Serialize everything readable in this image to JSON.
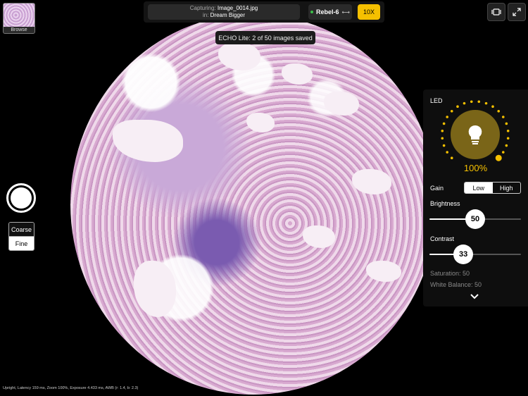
{
  "top": {
    "capturing_label": "Capturing:",
    "capturing_file": "Image_0014.jpg",
    "in_label": "in:",
    "in_folder": "Dream Bigger",
    "device_name": "Rebel-6",
    "device_link_icon": "link-icon",
    "objective": "10X"
  },
  "browse": {
    "label": "Browse"
  },
  "toast": {
    "text": "ECHO Lite: 2 of 50 images saved"
  },
  "focus": {
    "coarse": "Coarse",
    "fine": "Fine",
    "selected": "Fine"
  },
  "status": {
    "text": "Upright, Latency 159 ms, Zoom 100%, Exposure 4.433 ms, AWB (r: 1.4, b: 2.3)"
  },
  "panel": {
    "led_label": "LED",
    "led_icon": "lightbulb-icon",
    "led_percent": "100%",
    "led_level": 1.0,
    "gain_label": "Gain",
    "gain_low": "Low",
    "gain_high": "High",
    "gain_selected": "Low",
    "brightness_label": "Brightness",
    "brightness_value": "50",
    "brightness_level": 0.5,
    "contrast_label": "Contrast",
    "contrast_value": "33",
    "contrast_level": 0.37,
    "saturation_text": "Saturation: 50",
    "white_balance_text": "White Balance: 50",
    "collapse_icon": "chevron-down-icon"
  },
  "colors": {
    "accent": "#f5c000",
    "led_inner": "#7a6518"
  }
}
